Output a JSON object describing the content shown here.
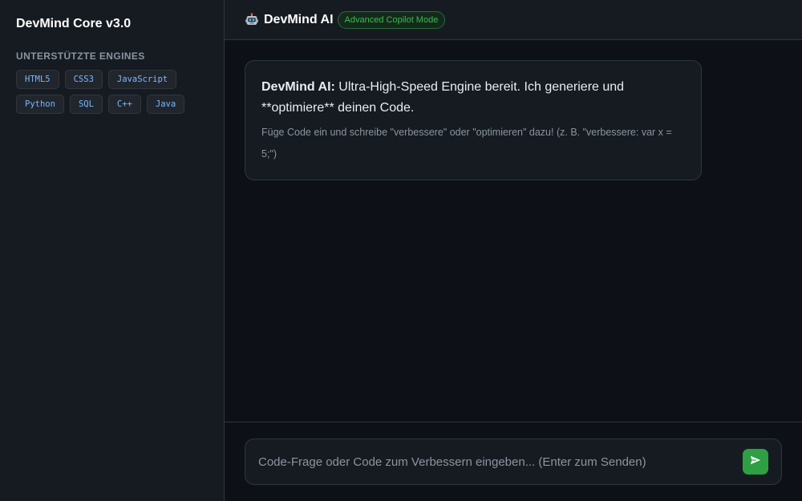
{
  "sidebar": {
    "title": "DevMind Core v3.0",
    "engines_heading": "UNTERSTÜTZTE ENGINES",
    "engines": [
      "HTML5",
      "CSS3",
      "JavaScript",
      "Python",
      "SQL",
      "C++",
      "Java"
    ]
  },
  "header": {
    "icon": "robot-icon",
    "title": "DevMind AI",
    "badge": "Advanced Copilot Mode"
  },
  "chat": {
    "messages": [
      {
        "author": "DevMind AI:",
        "text": " Ultra-High-Speed Engine bereit. Ich generiere und **optimiere** deinen Code.",
        "hint": "Füge Code ein und schreibe \"verbessere\" oder \"optimieren\" dazu! (z. B. \"verbessere: var x = 5;\")"
      }
    ]
  },
  "input": {
    "value": "",
    "placeholder": "Code-Frage oder Code zum Verbessern eingeben... (Enter zum Senden)",
    "send_icon": "send-icon"
  },
  "colors": {
    "background": "#0d1117",
    "panel": "#161b22",
    "accent_green": "#2ea043",
    "tag_text": "#79b8ff"
  }
}
